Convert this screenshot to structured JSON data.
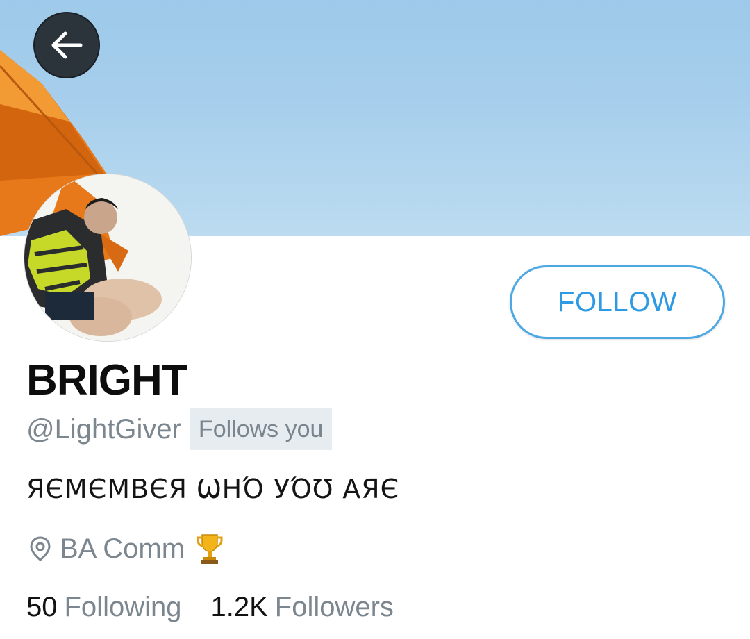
{
  "header": {
    "back_icon": "arrow-left-icon"
  },
  "profile": {
    "display_name": "BRIGHT",
    "handle": "@LightGiver",
    "follows_you_badge": "Follows you",
    "bio": "ЯЄМЄМВЄЯ ѠНΌ УΌƱ ΑЯЄ",
    "location": "BA Comm",
    "location_icon": "map-pin-icon",
    "trophy_icon": "trophy-icon",
    "follow_label": "FOLLOW"
  },
  "stats": {
    "following_count": "50",
    "following_label": "Following",
    "followers_count": "1.2K",
    "followers_label": "Followers"
  },
  "colors": {
    "accent": "#4ca8e3",
    "secondary_text": "#7c868f",
    "banner_sky": "#a7cfec"
  }
}
